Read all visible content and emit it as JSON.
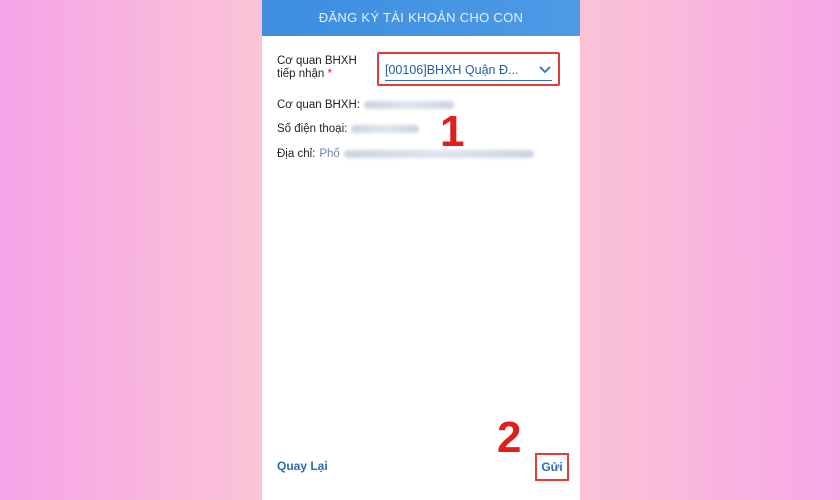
{
  "header": {
    "title": "ĐĂNG KÝ TÀI KHOẢN CHO CON"
  },
  "form": {
    "agency_label_line1": "Cơ quan BHXH",
    "agency_label_line2": "tiếp nhận",
    "required_mark": "*",
    "agency_selected": "[00106]BHXH Quận Đ..."
  },
  "info": {
    "agency_label": "Cơ quan BHXH:",
    "phone_label": "Số điện thoại:",
    "address_label": "Địa chỉ:",
    "address_value_prefix": "Phố"
  },
  "annotations": {
    "step1": "1",
    "step2": "2"
  },
  "footer": {
    "back_label": "Quay Lại",
    "send_label": "Gửi"
  },
  "colors": {
    "header_bg": "#4d9ae6",
    "highlight_border": "#e23b3b",
    "link_blue": "#2b6cb0",
    "annotation_red": "#e11d1d"
  },
  "icons": {
    "dropdown": "chevron-down-icon"
  }
}
